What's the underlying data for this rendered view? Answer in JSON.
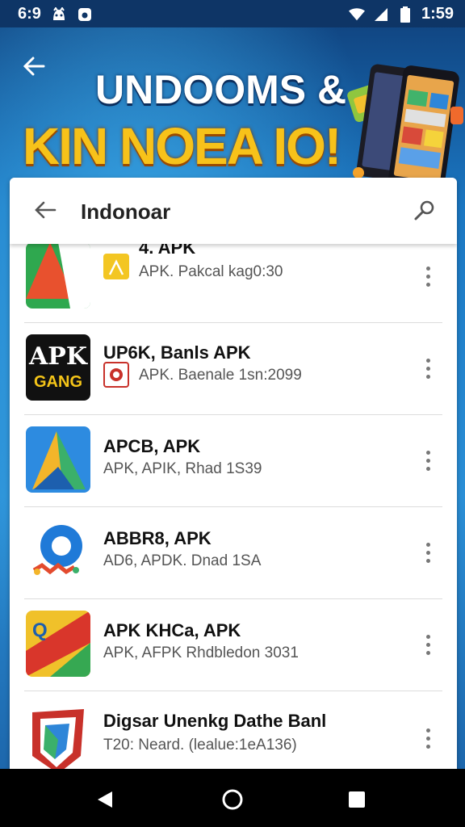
{
  "status": {
    "left_text": "6:9",
    "time": "1:59"
  },
  "banner": {
    "line1": "UNDOOMS &",
    "line2": "KIN NOEA IO!"
  },
  "search": {
    "query": "Indonoar"
  },
  "apps": [
    {
      "title": "4. APK",
      "subtitle": "APK. Pakcal kag0:30"
    },
    {
      "title": "UP6K, Banls APK",
      "subtitle": "APK. Baenale 1sn:2099"
    },
    {
      "title": "APCB, APK",
      "subtitle": "APK, APIK, Rhad 1S39"
    },
    {
      "title": "ABBR8, APK",
      "subtitle": "AD6, APDK. Dnad 1SA"
    },
    {
      "title": "APK KHCa, APK",
      "subtitle": "APK, AFPK  Rhdbledon 3031"
    },
    {
      "title": "Digsar Unenkg Dathe Banl",
      "subtitle": "T20: Neard. (lealue:1eA136)"
    }
  ],
  "icon_labels": {
    "apk_gang_line1": "APK",
    "apk_gang_line2": "GANG"
  },
  "colors": {
    "status_bar": "#0e3566",
    "headline_yellow": "#f7c21a",
    "nav_bar": "#000000"
  }
}
